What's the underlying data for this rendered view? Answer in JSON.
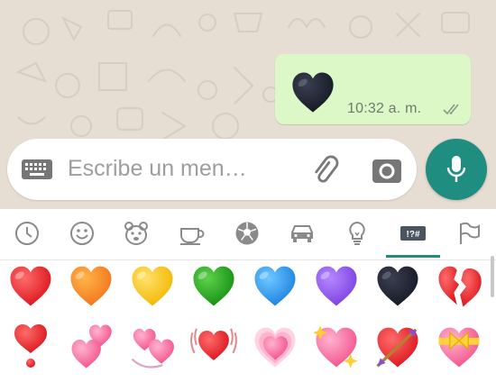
{
  "message": {
    "content": "black-heart-emoji",
    "time": "10:32 a. m.",
    "status_icon": "double-check-icon"
  },
  "composer": {
    "placeholder": "Escribe un men…",
    "left_icon": "keyboard-icon",
    "attach_icon": "paperclip-icon",
    "camera_icon": "camera-icon",
    "send_icon": "microphone-icon"
  },
  "colors": {
    "accent": "#1f8d80",
    "bubble": "#dcf8c6",
    "chat_bg": "#e6ded3"
  },
  "emoji_keyboard": {
    "categories": [
      {
        "icon": "clock-icon",
        "selected": false
      },
      {
        "icon": "smiley-icon",
        "selected": false
      },
      {
        "icon": "bear-icon",
        "selected": false
      },
      {
        "icon": "cup-icon",
        "selected": false
      },
      {
        "icon": "soccer-ball-icon",
        "selected": false
      },
      {
        "icon": "car-icon",
        "selected": false
      },
      {
        "icon": "lightbulb-icon",
        "selected": false
      },
      {
        "icon": "symbols-icon",
        "label": "!?#",
        "selected": true
      },
      {
        "icon": "flag-icon",
        "selected": false
      }
    ],
    "rows": [
      [
        "red-heart",
        "orange-heart",
        "yellow-heart",
        "green-heart",
        "blue-heart",
        "purple-heart",
        "black-heart",
        "broken-heart"
      ],
      [
        "heart-exclamation",
        "two-hearts",
        "revolving-hearts",
        "beating-heart",
        "growing-heart",
        "sparkling-heart",
        "heart-with-arrow",
        "heart-with-ribbon"
      ]
    ]
  }
}
